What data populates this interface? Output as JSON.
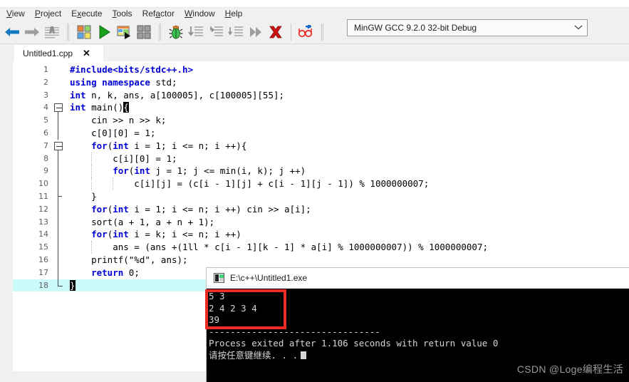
{
  "menu": {
    "items": [
      {
        "label": "View",
        "mnemonic": "V"
      },
      {
        "label": "Project",
        "mnemonic": "P"
      },
      {
        "label": "Execute",
        "mnemonic": "x"
      },
      {
        "label": "Tools",
        "mnemonic": "T"
      },
      {
        "label": "Refactor",
        "mnemonic": "a"
      },
      {
        "label": "Window",
        "mnemonic": "W"
      },
      {
        "label": "Help",
        "mnemonic": "H"
      }
    ]
  },
  "toolbar": {
    "back": "back-arrow-icon",
    "forward": "forward-arrow-icon",
    "format": "format-code-icon",
    "compile": "compile-icon",
    "run": "run-icon",
    "compile_run": "compile-and-run-icon",
    "rebuild": "rebuild-all-icon",
    "debug": "debug-bug-icon",
    "step_over": "step-over-icon",
    "step_into": "step-into-icon",
    "step_out": "step-out-icon",
    "next_fast": "continue-icon",
    "stop": "stop-execution-icon",
    "watch": "add-watch-icon"
  },
  "compiler": {
    "selected": "MinGW GCC 9.2.0 32-bit Debug",
    "arrow": "chevron-down-icon"
  },
  "tabs": [
    {
      "label": "Untitled1.cpp",
      "close": "✕"
    }
  ],
  "editor": {
    "lines": [
      {
        "n": "1",
        "text": "#include<bits/stdc++.h>",
        "kind": "pre"
      },
      {
        "n": "2",
        "text": "using namespace std;",
        "kind": "kw2"
      },
      {
        "n": "3",
        "text": "int n, k, ans, a[100005], c[100005][55];",
        "kind": "kw1"
      },
      {
        "n": "4",
        "text": "int main(){",
        "kind": "main"
      },
      {
        "n": "5",
        "text": "    cin >> n >> k;",
        "kind": "plain"
      },
      {
        "n": "6",
        "text": "    c[0][0] = 1;",
        "kind": "plain"
      },
      {
        "n": "7",
        "text": "    for(int i = 1; i <= n; i ++){",
        "kind": "forint"
      },
      {
        "n": "8",
        "text": "        c[i][0] = 1;",
        "kind": "plain"
      },
      {
        "n": "9",
        "text": "        for(int j = 1; j <= min(i, k); j ++)",
        "kind": "forint"
      },
      {
        "n": "10",
        "text": "            c[i][j] = (c[i - 1][j] + c[i - 1][j - 1]) % 1000000007;",
        "kind": "plain"
      },
      {
        "n": "11",
        "text": "    }",
        "kind": "plain"
      },
      {
        "n": "12",
        "text": "    for(int i = 1; i <= n; i ++) cin >> a[i];",
        "kind": "forint"
      },
      {
        "n": "13",
        "text": "    sort(a + 1, a + n + 1);",
        "kind": "plain"
      },
      {
        "n": "14",
        "text": "    for(int i = k; i <= n; i ++)",
        "kind": "forint"
      },
      {
        "n": "15",
        "text": "        ans = (ans +(1ll * c[i - 1][k - 1] * a[i] % 1000000007)) % 1000000007;",
        "kind": "plain"
      },
      {
        "n": "16",
        "text": "    printf(\"%d\", ans);",
        "kind": "plain"
      },
      {
        "n": "17",
        "text": "    return 0;",
        "kind": "ret"
      },
      {
        "n": "18",
        "text": "}",
        "kind": "closebrace"
      }
    ]
  },
  "console": {
    "title": "E:\\c++\\Untitled1.exe",
    "title_icon": "console-app-icon",
    "output": [
      "5 3",
      "2 4 2 3 4",
      "39",
      "--------------------------------",
      "Process exited after 1.106 seconds with return value 0",
      "请按任意键继续. . ."
    ],
    "input_line": "5 3",
    "input_array": "2 4 2 3 4",
    "result": "39",
    "separator": "--------------------------------",
    "exit_message": "Process exited after 1.106 seconds with return value 0",
    "press_any_key": "请按任意键继续. . .",
    "exit_seconds": "1.106",
    "return_value": "0"
  },
  "annotation": {
    "highlight_color": "#ef2b26",
    "name": "red-highlight-box"
  },
  "watermark": {
    "text": "CSDN @Loge编程生活",
    "color": "#9a9a9a"
  }
}
